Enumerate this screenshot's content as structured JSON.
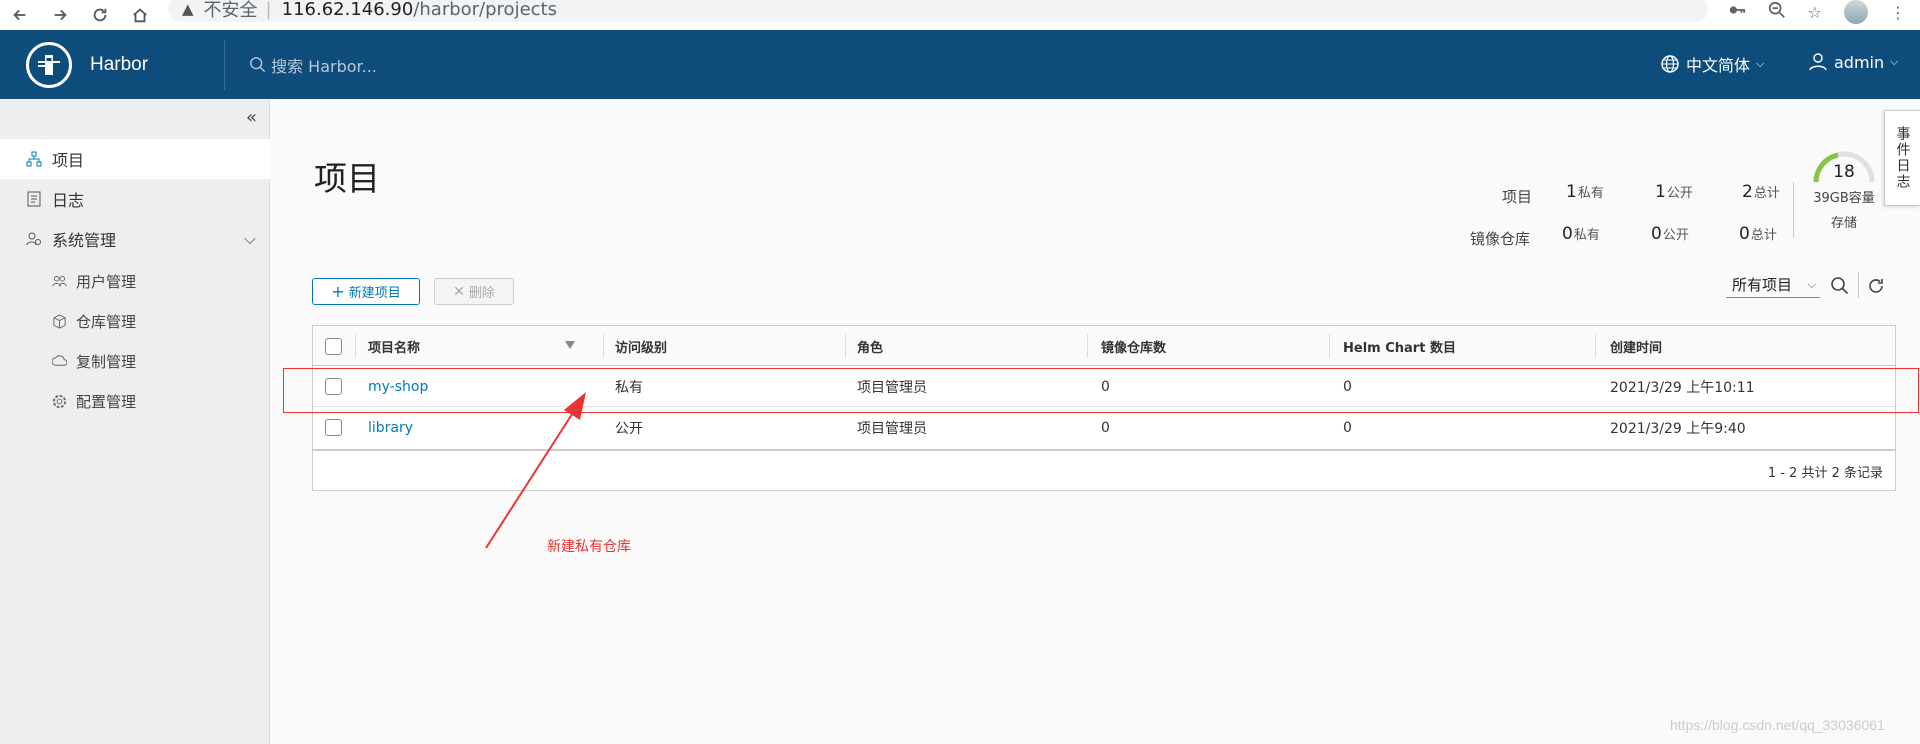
{
  "browser": {
    "insecure_label": "不安全",
    "separator": "|",
    "url_host": "116.62.146.90",
    "url_path": "/harbor/projects"
  },
  "header": {
    "brand": "Harbor",
    "search_placeholder": "搜索 Harbor...",
    "language": "中文简体",
    "user": "admin",
    "bg_color": "#0e4c7c"
  },
  "sidebar": {
    "items": [
      {
        "label": "项目",
        "icon": "projects-icon",
        "active": true
      },
      {
        "label": "日志",
        "icon": "log-icon"
      },
      {
        "label": "系统管理",
        "icon": "admin-icon",
        "expanded": true
      }
    ],
    "sub_items": [
      {
        "label": "用户管理",
        "icon": "users-icon"
      },
      {
        "label": "仓库管理",
        "icon": "registry-icon"
      },
      {
        "label": "复制管理",
        "icon": "replication-icon"
      },
      {
        "label": "配置管理",
        "icon": "config-icon"
      }
    ]
  },
  "page": {
    "title": "项目"
  },
  "stats": {
    "projects_label": "项目",
    "repos_label": "镜像仓库",
    "private_unit": "私有",
    "public_unit": "公开",
    "total_unit": "总计",
    "projects": {
      "private": "1",
      "public": "1",
      "total": "2"
    },
    "repos": {
      "private": "0",
      "public": "0",
      "total": "0"
    }
  },
  "storage": {
    "value": "18",
    "capacity": "39GB容量",
    "label": "存储",
    "gauge_color": "#8bc34a"
  },
  "event_tab": {
    "label": "事件日志"
  },
  "toolbar": {
    "new_label": "新建项目",
    "delete_label": "删除",
    "filter_label": "所有项目"
  },
  "table": {
    "headers": [
      "项目名称",
      "访问级别",
      "角色",
      "镜像仓库数",
      "Helm Chart 数目",
      "创建时间"
    ],
    "rows": [
      {
        "name": "my-shop",
        "access": "私有",
        "role": "项目管理员",
        "repos": "0",
        "charts": "0",
        "created": "2021/3/29 上午10:11"
      },
      {
        "name": "library",
        "access": "公开",
        "role": "项目管理员",
        "repos": "0",
        "charts": "0",
        "created": "2021/3/29 上午9:40"
      }
    ],
    "footer": "1 - 2 共计 2 条记录"
  },
  "annotation": {
    "text": "新建私有仓库",
    "color": "#ee3333"
  },
  "watermark": "https://blog.csdn.net/qq_33036061"
}
